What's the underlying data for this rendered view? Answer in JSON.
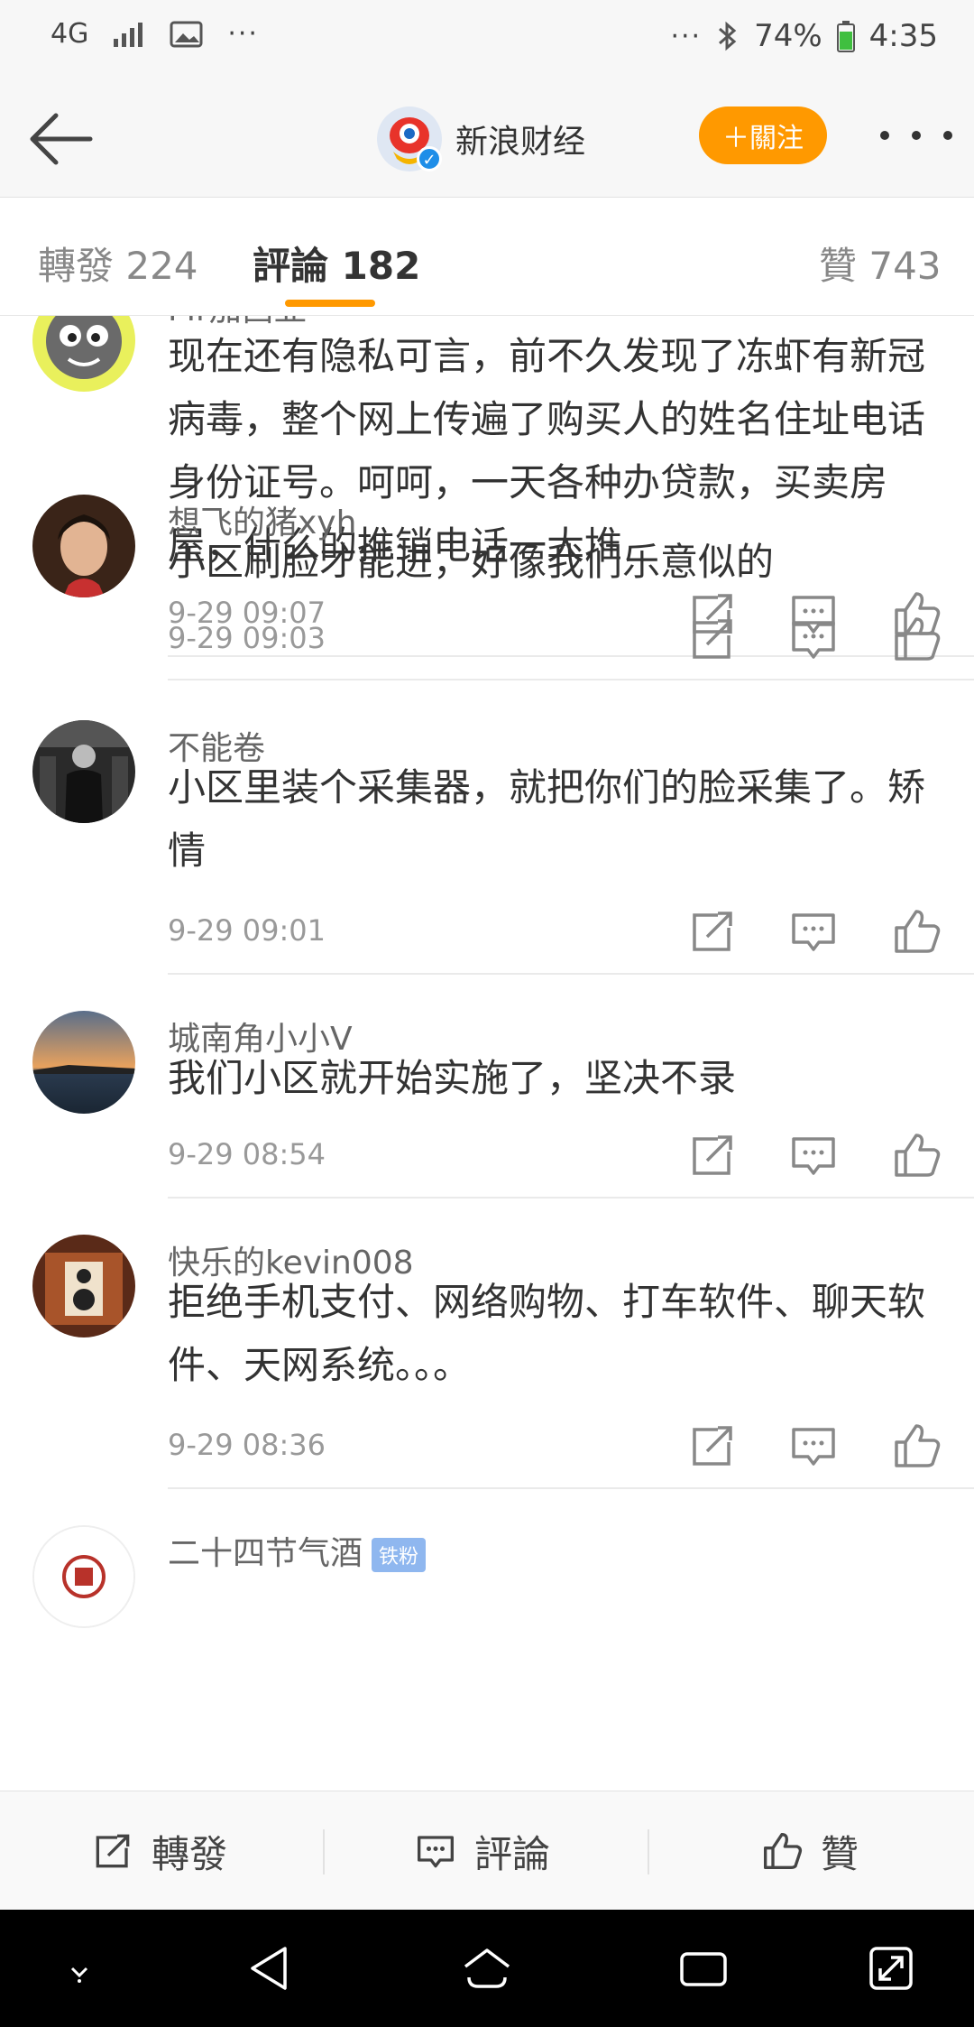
{
  "status_bar": {
    "network": "4G",
    "overflow": "···",
    "overflow_right": "···",
    "battery": "74%",
    "time": "4:35"
  },
  "header": {
    "account_name": "新浪财经",
    "follow_label": "＋關注"
  },
  "tabs": {
    "repost": "轉發 224",
    "comment": "評論 182",
    "like": "贊 743"
  },
  "comments": [
    {
      "name": "Mr加西亚",
      "text": "现在还有隐私可言，前不久发现了冻虾有新冠病毒，整个网上传遍了购买人的姓名住址电话身份证号。呵呵，一天各种办贷款，买卖房屋，什么的推销电话一大堆",
      "time": "9-29 09:07"
    },
    {
      "name": "想飞的猪xyh",
      "text": "小区刷脸才能进，好像我们乐意似的",
      "time": "9-29 09:03"
    },
    {
      "name": "不能卷",
      "text": "小区里装个采集器，就把你们的脸采集了。矫情",
      "time": "9-29 09:01"
    },
    {
      "name": "城南角小小V",
      "text": "我们小区就开始实施了，坚决不录",
      "time": "9-29 08:54"
    },
    {
      "name": "快乐的kevin008",
      "text": "拒绝手机支付、网络购物、打车软件、聊天软件、天网系统。。。",
      "time": "9-29 08:36"
    },
    {
      "name": "二十四节气酒",
      "badge": "铁粉"
    }
  ],
  "bottom_bar": {
    "repost": "轉發",
    "comment": "評論",
    "like": "贊"
  },
  "colors": {
    "accent": "#ff9900",
    "verified": "#1f8ee8"
  }
}
